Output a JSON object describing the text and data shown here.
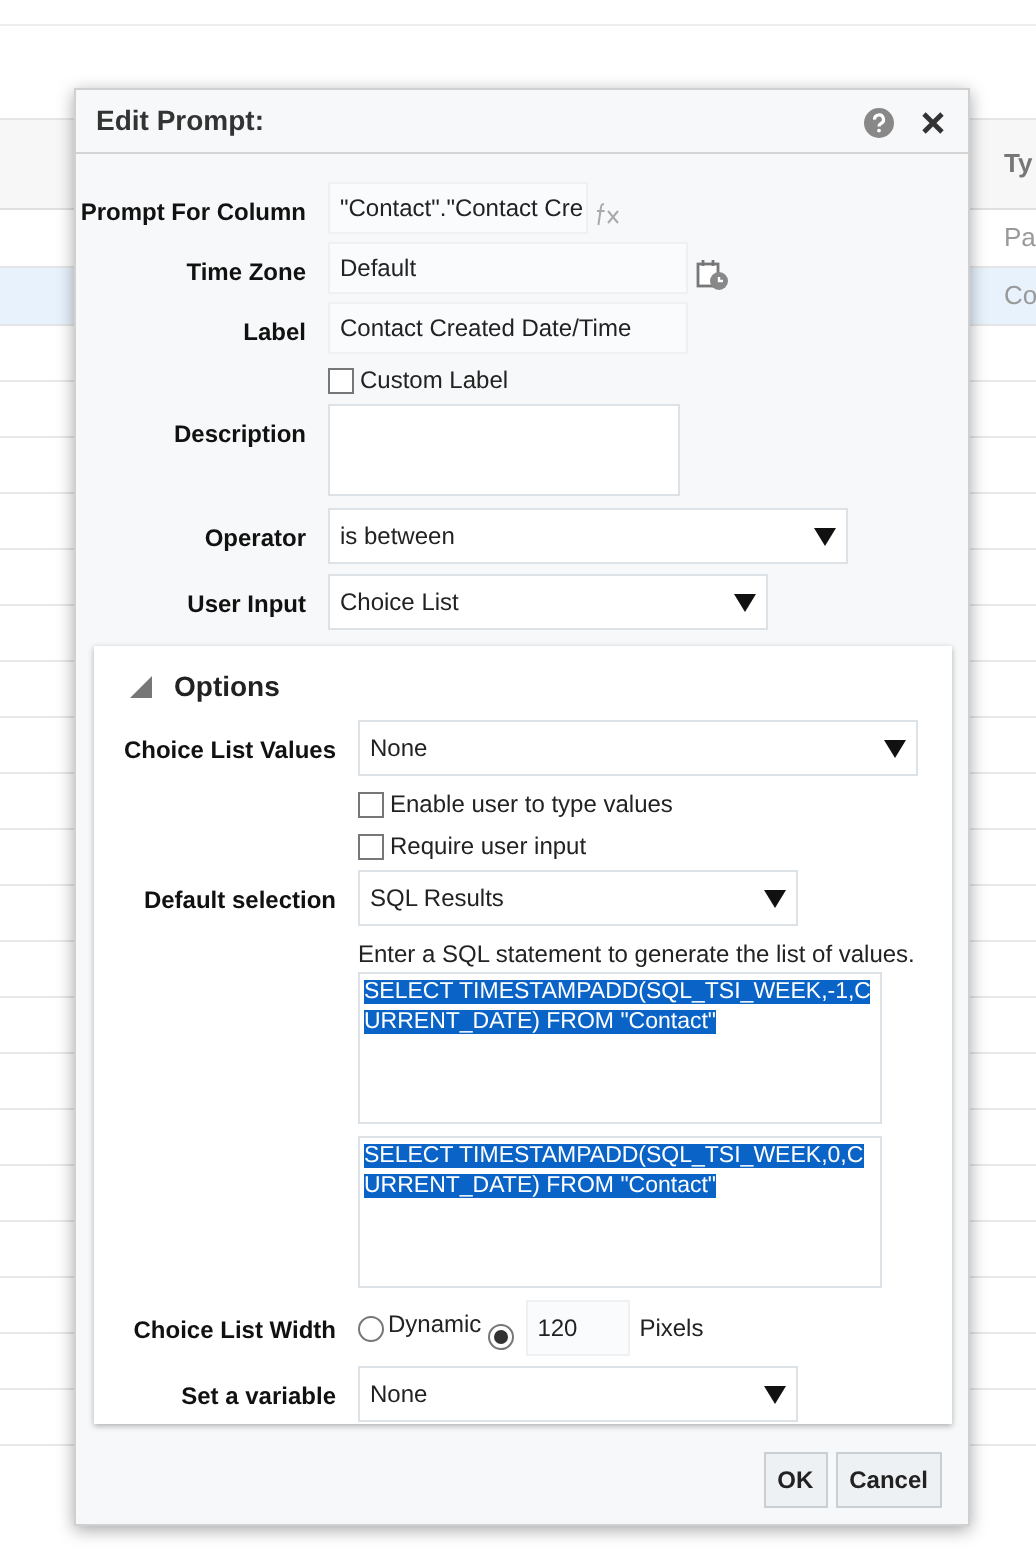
{
  "background_table": {
    "column_header": "Ty",
    "rows": [
      {
        "cell": "Pa",
        "selected": false
      },
      {
        "cell": "Co",
        "selected": true
      }
    ]
  },
  "dialog": {
    "title": "Edit Prompt:",
    "fields": [
      {
        "kind": "text",
        "label": "Prompt For Column",
        "value": "\"Contact\".\"Contact Cre"
      },
      {
        "kind": "text",
        "label": "Time Zone",
        "value": "Default"
      },
      {
        "kind": "text",
        "label": "Label",
        "value": "Contact Created Date/Time"
      },
      {
        "kind": "checkbox",
        "text": "Custom Label",
        "checked": false
      },
      {
        "kind": "textarea",
        "label": "Description"
      },
      {
        "kind": "select",
        "label": "Operator",
        "value": "is between"
      },
      {
        "kind": "select",
        "label": "User Input",
        "value": "Choice List"
      }
    ],
    "options": {
      "title": "Options",
      "expanded": true,
      "fields": [
        {
          "kind": "select",
          "label": "Choice List Values",
          "value": "None"
        },
        {
          "kind": "checkbox",
          "text": "Enable user to type values",
          "checked": false
        },
        {
          "kind": "checkbox",
          "text": "Require user input",
          "checked": false
        },
        {
          "kind": "select",
          "label": "Default selection",
          "value": "SQL Results"
        },
        {
          "kind": "hint",
          "text": "Enter a SQL statement to generate the list of values."
        },
        {
          "kind": "sql",
          "value": "SELECT TIMESTAMPADD(SQL_TSI_WEEK,-1,CURRENT_DATE) FROM \"Contact\"",
          "highlighted": true
        },
        {
          "kind": "sql",
          "value": "SELECT TIMESTAMPADD(SQL_TSI_WEEK,0,CURRENT_DATE) FROM \"Contact\"",
          "highlighted": true
        },
        {
          "kind": "width",
          "label": "Choice List Width",
          "radios": [
            {
              "text": "Dynamic",
              "selected": false
            },
            {
              "selected": true
            }
          ],
          "value": "120",
          "unit": "Pixels"
        },
        {
          "kind": "select",
          "label": "Set a variable",
          "value": "None"
        }
      ]
    },
    "buttons": [
      "OK",
      "Cancel"
    ]
  }
}
